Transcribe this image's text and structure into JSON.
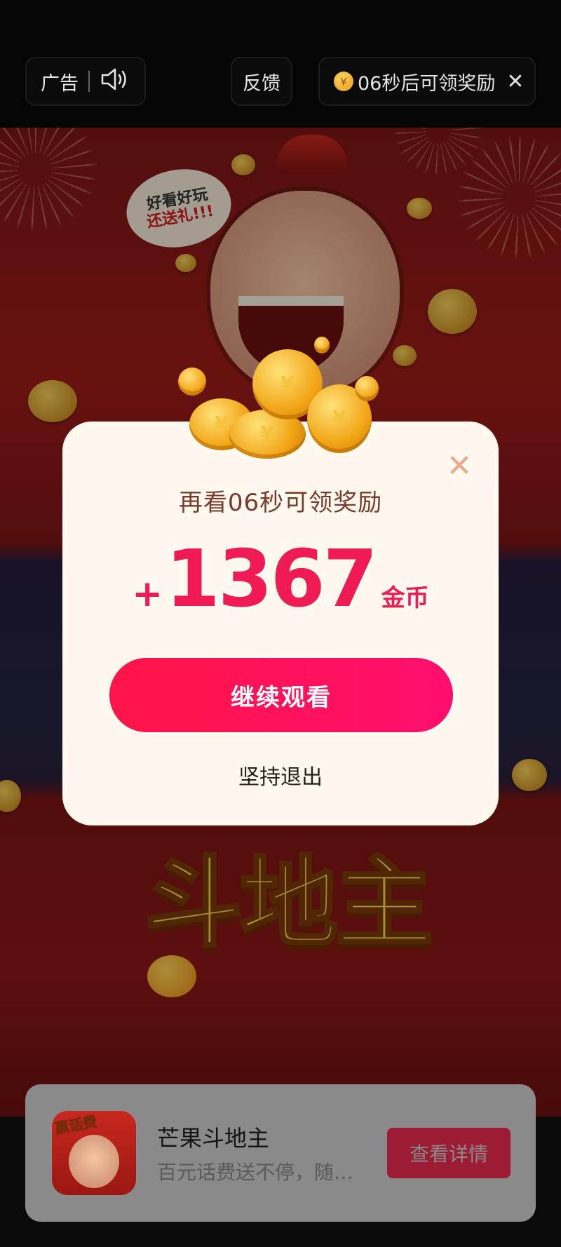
{
  "top_bar": {
    "ad_label": "广告",
    "feedback_label": "反馈",
    "reward_countdown": "06秒后可领奖励",
    "coin_glyph": "¥",
    "close_glyph": "✕"
  },
  "background_ad": {
    "speech_bubble_line1": "好看好玩",
    "speech_bubble_line2": "还送礼!!!",
    "game_title": "斗地主"
  },
  "modal": {
    "countdown_text": "再看06秒可领奖励",
    "plus_sign": "+",
    "coin_amount": "1367",
    "coin_unit": "金币",
    "continue_label": "继续观看",
    "exit_label": "坚持退出",
    "close_glyph": "✕",
    "accent_color": "#f01a55"
  },
  "ad_card": {
    "app_icon_tag": "赢话费",
    "app_name": "芒果斗地主",
    "app_description": "百元话费送不停，随…",
    "detail_button_label": "查看详情"
  }
}
